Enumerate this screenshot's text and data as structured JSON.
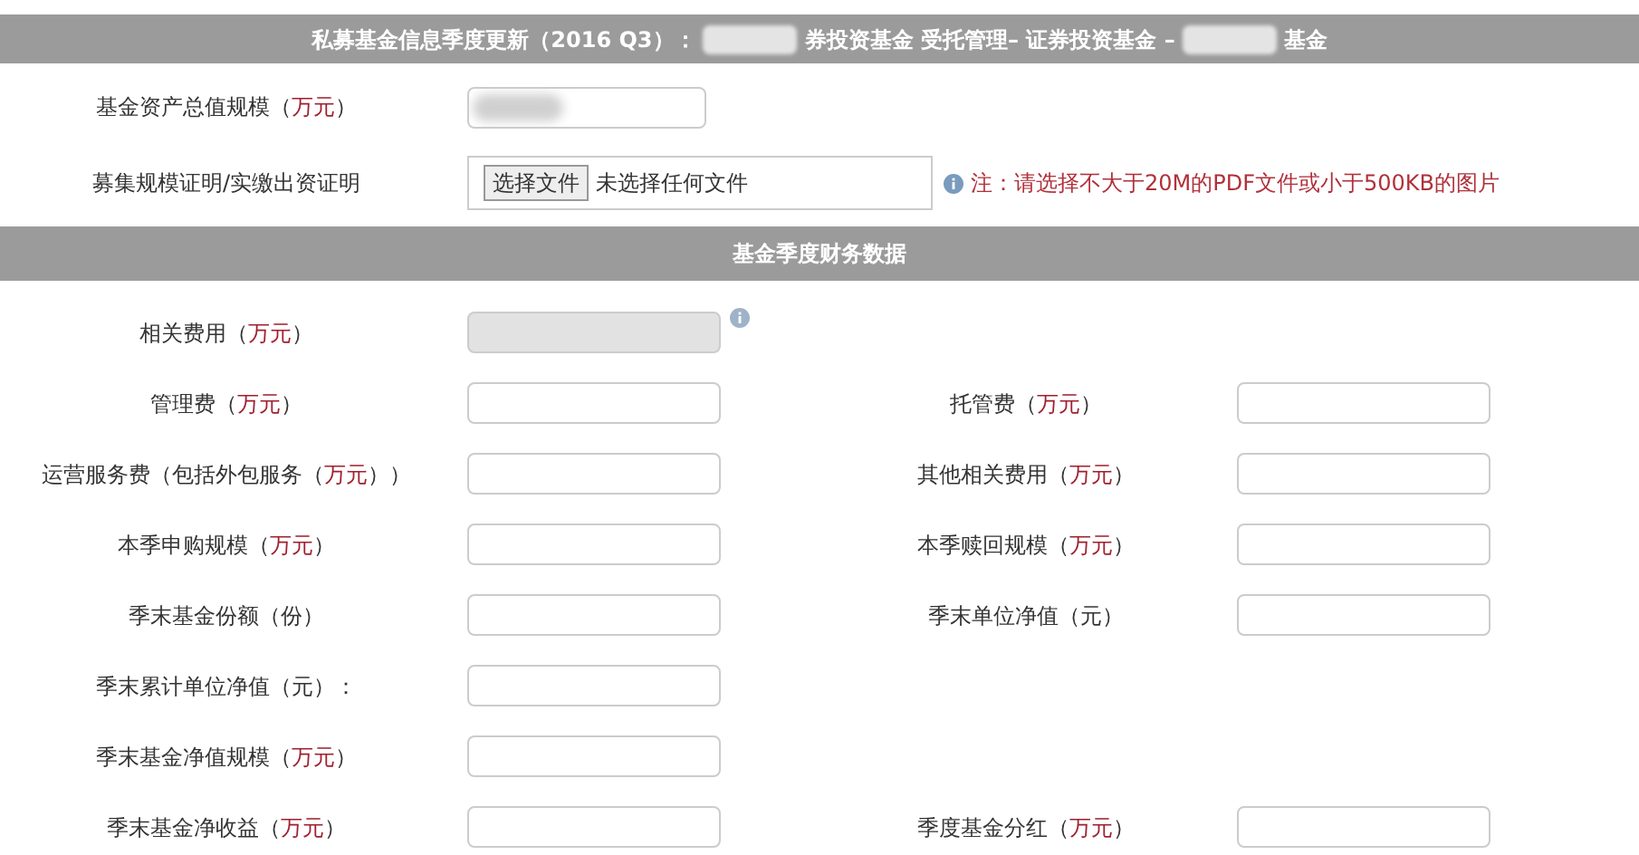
{
  "title_parts": [
    {
      "kind": "text",
      "text": "私募基金信息季度更新（2016 Q3）："
    },
    {
      "kind": "redacted"
    },
    {
      "kind": "text",
      "text": "券投资基金 受托管理– 证券投资基金 –"
    },
    {
      "kind": "redacted"
    },
    {
      "kind": "text",
      "text": "基金"
    }
  ],
  "asset_field": {
    "label": "基金资产总值规模（",
    "unit": "万元",
    "tail": "）",
    "redacted": true
  },
  "upload": {
    "label": "募集规模证明/实缴出资证明",
    "button": "选择文件",
    "status": "未选择任何文件",
    "note": "注：请选择不大于20M的PDF文件或小于500KB的图片"
  },
  "section_title": "基金季度财务数据",
  "rows": [
    {
      "left": {
        "label": "相关费用（",
        "unit": "万元",
        "tail": "）",
        "disabled": true,
        "info": true
      }
    },
    {
      "left": {
        "label": "管理费（",
        "unit": "万元",
        "tail": "）",
        "disabled": false
      },
      "right": {
        "label": "托管费（",
        "unit": "万元",
        "tail": "）",
        "disabled": false
      }
    },
    {
      "left": {
        "label": "运营服务费（包括外包服务（",
        "unit": "万元",
        "tail": "））",
        "disabled": false
      },
      "right": {
        "label": "其他相关费用（",
        "unit": "万元",
        "tail": "）",
        "disabled": false
      }
    },
    {
      "left": {
        "label": "本季申购规模（",
        "unit": "万元",
        "tail": "）",
        "disabled": false
      },
      "right": {
        "label": "本季赎回规模（",
        "unit": "万元",
        "tail": "）",
        "disabled": false
      }
    },
    {
      "left": {
        "label": "季末基金份额（份）",
        "disabled": false
      },
      "right": {
        "label": "季末单位净值（元）",
        "disabled": false
      }
    },
    {
      "left": {
        "label": "季末累计单位净值（元）：",
        "disabled": false
      }
    },
    {
      "left": {
        "label": "季末基金净值规模（",
        "unit": "万元",
        "tail": "）",
        "disabled": false
      }
    },
    {
      "left": {
        "label": "季末基金净收益（",
        "unit": "万元",
        "tail": "）",
        "disabled": false
      },
      "right": {
        "label": "季度基金分红（",
        "unit": "万元",
        "tail": "）",
        "disabled": false
      }
    }
  ]
}
